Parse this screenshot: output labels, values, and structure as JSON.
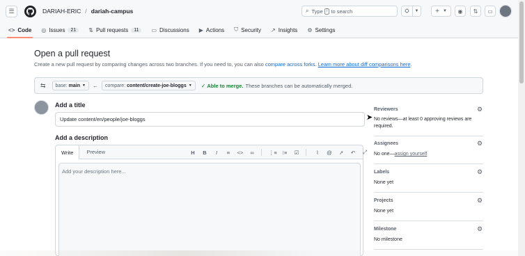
{
  "topbar": {
    "owner": "DARIAH-ERIC",
    "separator": "/",
    "repo": "dariah-campus",
    "search_prefix": "Type",
    "search_key": "/",
    "search_suffix": "to search",
    "new_label": "+"
  },
  "nav": {
    "code": "Code",
    "issues": "Issues",
    "issues_count": "21",
    "pull_requests": "Pull requests",
    "pull_requests_count": "11",
    "discussions": "Discussions",
    "actions": "Actions",
    "security": "Security",
    "insights": "Insights",
    "settings": "Settings"
  },
  "page": {
    "title": "Open a pull request",
    "description": "Create a new pull request by comparing changes across two branches. If you need to, you can also ",
    "compare_forks_link": "compare across forks",
    "description_end": ". ",
    "learn_more_link": "Learn more about diff comparisons here",
    "learn_more_end": "."
  },
  "compare": {
    "base_prefix": "base:",
    "base_branch": "main",
    "compare_prefix": "compare:",
    "compare_branch": "content/create-joe-bloggs",
    "merge_status": "Able to merge.",
    "merge_message": "These branches can be automatically merged."
  },
  "form": {
    "title_label": "Add a title",
    "title_value": "Update content/en/people/joe-bloggs",
    "description_label": "Add a description",
    "tab_write": "Write",
    "tab_preview": "Preview",
    "description_placeholder": "Add your description here..."
  },
  "sidebar": {
    "reviewers_title": "Reviewers",
    "reviewers_value": "No reviews—at least 0 approving reviews are required.",
    "assignees_title": "Assignees",
    "assignees_value": "No one—",
    "assign_yourself": "assign yourself",
    "labels_title": "Labels",
    "labels_value": "None yet",
    "projects_title": "Projects",
    "projects_value": "None yet",
    "milestone_title": "Milestone",
    "milestone_value": "No milestone"
  },
  "icons": {
    "menu": "hamburger-icon",
    "logo": "github-logo-icon",
    "merge_ok": "check-icon",
    "gear": "gear-icon"
  },
  "colors": {
    "link": "#0969da",
    "success": "#1a7f37",
    "active_tab_underline": "#fd8c73"
  }
}
